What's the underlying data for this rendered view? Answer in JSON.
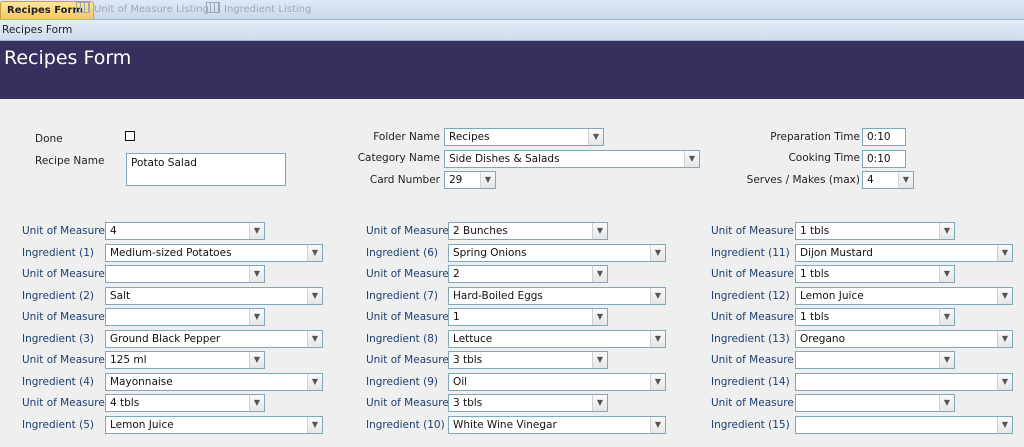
{
  "tabs": [
    {
      "label": "Recipes Form",
      "active": true
    },
    {
      "label": "Unit of Measure Listing",
      "active": false
    },
    {
      "label": "Ingredient Listing",
      "active": false
    }
  ],
  "subheader": "Recipes Form",
  "banner_title": "Recipes Form",
  "header_fields": {
    "done_label": "Done",
    "recipe_name_label": "Recipe Name",
    "recipe_name_value": "Potato Salad",
    "folder_name_label": "Folder Name",
    "folder_name_value": "Recipes",
    "category_name_label": "Category Name",
    "category_name_value": "Side Dishes & Salads",
    "card_number_label": "Card Number",
    "card_number_value": "29",
    "prep_time_label": "Preparation Time",
    "prep_time_value": "0:10",
    "cooking_time_label": "Cooking Time",
    "cooking_time_value": "0:10",
    "serves_label": "Serves / Makes (max)",
    "serves_value": "4"
  },
  "uom_label": "Unit of Measure",
  "ingredients": [
    {
      "label": "Ingredient (1)",
      "uom": "4",
      "name": "Medium-sized Potatoes"
    },
    {
      "label": "Ingredient (2)",
      "uom": "",
      "name": "Salt"
    },
    {
      "label": "Ingredient (3)",
      "uom": "",
      "name": "Ground Black Pepper"
    },
    {
      "label": "Ingredient (4)",
      "uom": "125 ml",
      "name": "Mayonnaise"
    },
    {
      "label": "Ingredient (5)",
      "uom": "4 tbls",
      "name": "Lemon Juice"
    },
    {
      "label": "Ingredient (6)",
      "uom": "2 Bunches",
      "name": "Spring Onions"
    },
    {
      "label": "Ingredient (7)",
      "uom": "2",
      "name": "Hard-Boiled Eggs"
    },
    {
      "label": "Ingredient (8)",
      "uom": "1",
      "name": "Lettuce"
    },
    {
      "label": "Ingredient (9)",
      "uom": "3 tbls",
      "name": "Oil"
    },
    {
      "label": "Ingredient (10)",
      "uom": "3 tbls",
      "name": "White Wine Vinegar"
    },
    {
      "label": "Ingredient (11)",
      "uom": "1 tbls",
      "name": "Dijon Mustard"
    },
    {
      "label": "Ingredient (12)",
      "uom": "1 tbls",
      "name": "Lemon Juice"
    },
    {
      "label": "Ingredient (13)",
      "uom": "1 tbls",
      "name": "Oregano"
    },
    {
      "label": "Ingredient (14)",
      "uom": "",
      "name": ""
    },
    {
      "label": "Ingredient (15)",
      "uom": "",
      "name": ""
    }
  ]
}
